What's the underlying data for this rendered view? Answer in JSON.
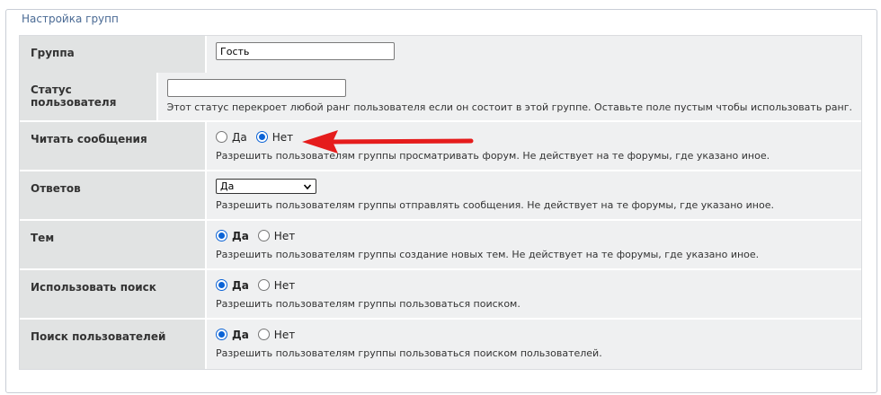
{
  "panel": {
    "legend": "Настройка групп"
  },
  "rows": [
    {
      "label": "Группа",
      "input_value": "Гость"
    },
    {
      "label": "Статус пользователя",
      "input_value": "",
      "hint": "Этот статус перекроет любой ранг пользователя если он состоит в этой группе. Оставьте поле пустым чтобы использовать ранг."
    },
    {
      "label": "Читать сообщения",
      "options": [
        "Да",
        "Нет"
      ],
      "selected": "Нет",
      "hint": "Разрешить пользователям группы просматривать форум. Не действует на те форумы, где указано иное."
    },
    {
      "label": "Ответов",
      "select_value": "Да",
      "hint": "Разрешить пользователям группы отправлять сообщения. Не действует на те форумы, где указано иное."
    },
    {
      "label": "Тем",
      "options": [
        "Да",
        "Нет"
      ],
      "selected": "Да",
      "hint": "Разрешить пользователям группы создание новых тем. Не действует на те форумы, где указано иное."
    },
    {
      "label": "Использовать поиск",
      "options": [
        "Да",
        "Нет"
      ],
      "selected": "Да",
      "hint": "Разрешить пользователям группы пользоваться поиском."
    },
    {
      "label": "Поиск пользователей",
      "options": [
        "Да",
        "Нет"
      ],
      "selected": "Да",
      "hint": "Разрешить пользователям группы пользоваться поиском пользователей."
    }
  ],
  "colors": {
    "legend_text": "#4a6a94",
    "label_bg": "#e1e3e3",
    "value_bg": "#eff0f1",
    "radio_checked": "#0b63d6",
    "annotation_arrow": "#e51c1c"
  },
  "icons": {
    "select_chevron": "chevron-down-icon",
    "annotation": "red-arrow-icon"
  }
}
